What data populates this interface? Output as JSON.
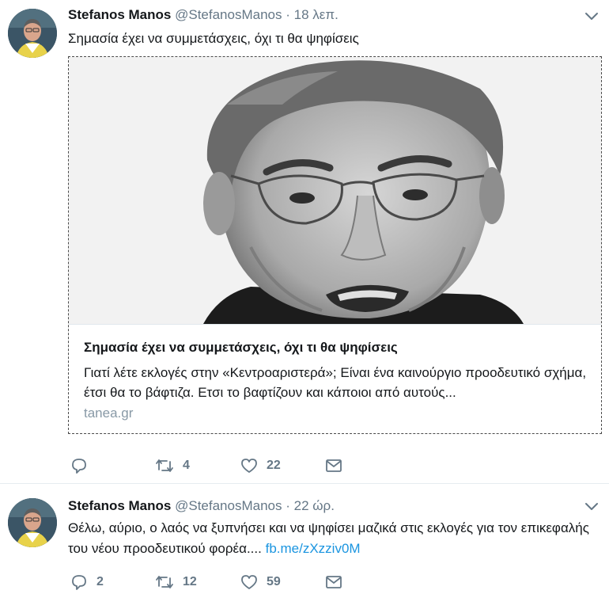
{
  "tweets": [
    {
      "name": "Stefanos Manos",
      "handle": "@StefanosManos",
      "separator": "·",
      "time": "18 λεπ.",
      "text": "Σημασία έχει να συμμετάσχεις, όχι τι θα ψηφίσεις",
      "card": {
        "title": "Σημασία έχει να συμμετάσχεις, όχι τι θα ψηφίσεις",
        "description": "Γιατί λέτε εκλογές στην «Κεντροαριστερά»; Είναι ένα καινούργιο προοδευτικό σχήμα, έτσι θα το βάφτιζα. Ετσι το βαφτίζουν και κάποιοι από αυτούς...",
        "domain": "tanea.gr"
      },
      "actions": {
        "replies": "",
        "retweets": "4",
        "likes": "22"
      }
    },
    {
      "name": "Stefanos Manos",
      "handle": "@StefanosManos",
      "separator": "·",
      "time": "22 ώρ.",
      "text": "Θέλω, αύριο, ο λαός να ξυπνήσει και να ψηφίσει μαζικά στις εκλογές για τον επικεφαλής του νέου προοδευτικού φορέα....",
      "link": "fb.me/zXzziv0M",
      "actions": {
        "replies": "2",
        "retweets": "12",
        "likes": "59"
      }
    }
  ],
  "colors": {
    "text": "#14171a",
    "secondary": "#657786",
    "link": "#1b95e0",
    "divider": "#e6ecf0"
  },
  "icons": [
    "avatar",
    "chevron-down-icon",
    "reply-icon",
    "retweet-icon",
    "like-icon",
    "dm-icon"
  ]
}
